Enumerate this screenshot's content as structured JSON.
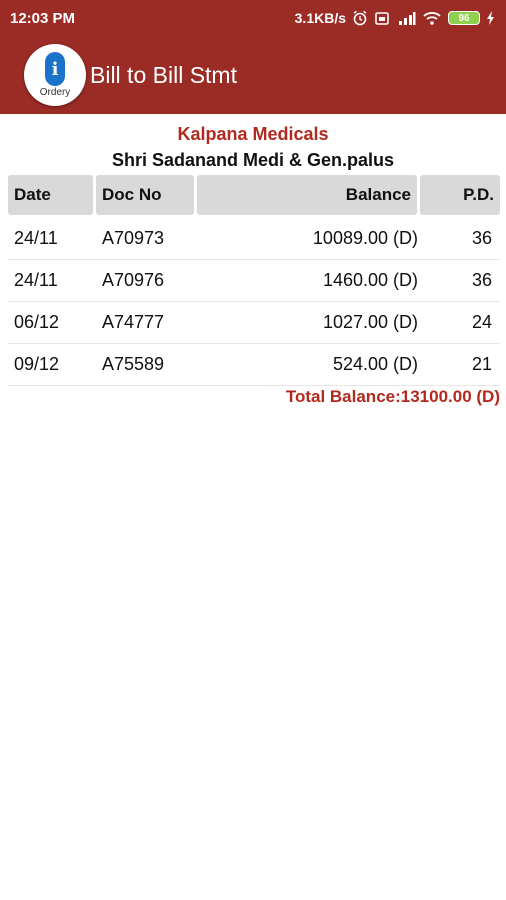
{
  "status": {
    "time": "12:03 PM",
    "speed": "3.1KB/s",
    "battery": "96"
  },
  "appbar": {
    "logo_text": "Ordery",
    "title": "Bill to Bill Stmt"
  },
  "report": {
    "company": "Kalpana Medicals",
    "party": "Shri Sadanand Medi & Gen.palus",
    "columns": {
      "date": "Date",
      "doc_no": "Doc No",
      "balance": "Balance",
      "pd": "P.D."
    },
    "rows": [
      {
        "date": "24/11",
        "doc_no": "A70973",
        "balance": "10089.00 (D)",
        "pd": "36"
      },
      {
        "date": "24/11",
        "doc_no": "A70976",
        "balance": "1460.00 (D)",
        "pd": "36"
      },
      {
        "date": "06/12",
        "doc_no": "A74777",
        "balance": "1027.00 (D)",
        "pd": "24"
      },
      {
        "date": "09/12",
        "doc_no": "A75589",
        "balance": "524.00 (D)",
        "pd": "21"
      }
    ],
    "total": "Total Balance:13100.00 (D)"
  },
  "colors": {
    "primary": "#9b2b25",
    "accent_text": "#b22a1f",
    "header_bg": "#d9d9d9"
  }
}
